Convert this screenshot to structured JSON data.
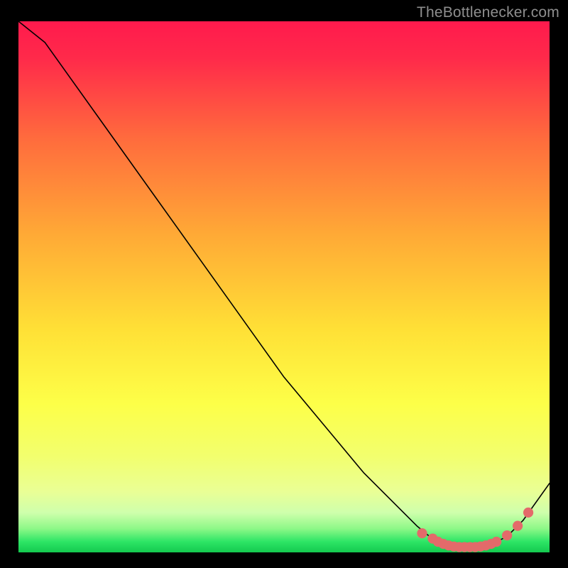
{
  "attribution": "TheBottlenecker.com",
  "colors": {
    "bg": "#000000",
    "attribution_text": "#8e8e8e",
    "line": "#000000",
    "marker": "#e36a6a",
    "gradient_top": "#ff1a4d",
    "gradient_mid_upper": "#ff803c",
    "gradient_mid": "#ffe236",
    "gradient_mid_lower": "#f7ff5c",
    "gradient_bottom": "#18e05a"
  },
  "chart_data": {
    "type": "line",
    "title": "",
    "xlabel": "",
    "ylabel": "",
    "xlim": [
      0,
      100
    ],
    "ylim": [
      0,
      100
    ],
    "series": [
      {
        "name": "curve",
        "x": [
          0,
          5,
          10,
          15,
          20,
          25,
          30,
          35,
          40,
          45,
          50,
          55,
          60,
          65,
          70,
          75,
          78,
          80,
          82,
          85,
          88,
          90,
          92,
          95,
          100
        ],
        "y": [
          100,
          96,
          89,
          82,
          75,
          68,
          61,
          54,
          47,
          40,
          33,
          27,
          21,
          15,
          10,
          5,
          2.5,
          1.5,
          1,
          1,
          1.5,
          2,
          3,
          6,
          13
        ]
      }
    ],
    "markers": {
      "name": "highlight-dots",
      "x": [
        76,
        78,
        79,
        80,
        81,
        82,
        83,
        84,
        85,
        86,
        87,
        88,
        89,
        90,
        92,
        94,
        96
      ],
      "y": [
        3.6,
        2.6,
        2.0,
        1.6,
        1.3,
        1.1,
        1.0,
        1.0,
        1.0,
        1.0,
        1.1,
        1.3,
        1.6,
        2.0,
        3.2,
        5.0,
        7.5
      ]
    }
  }
}
